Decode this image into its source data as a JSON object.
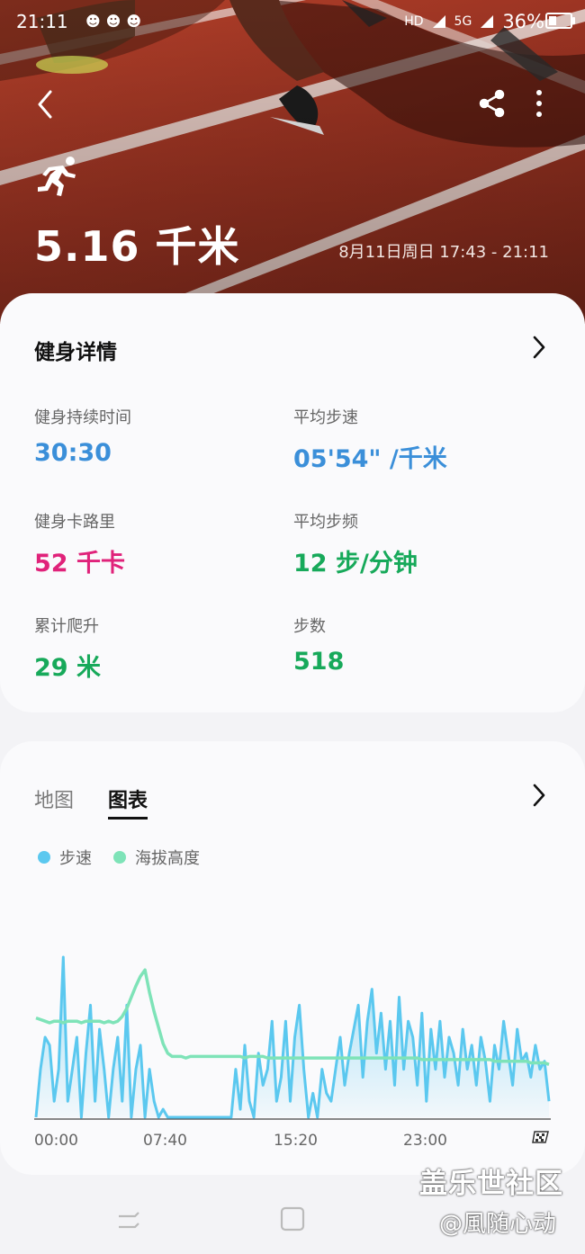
{
  "status": {
    "time": "21:11",
    "notif_icons": "☻☻☻",
    "hd": "HD",
    "net": "5G",
    "battery": "36%"
  },
  "header": {
    "back_icon": "chevron-left-icon",
    "share_icon": "share-icon",
    "more_icon": "more-vertical-icon",
    "activity_icon": "running-icon",
    "distance": "5.16 千米",
    "date_range": "8月11日周日 17:43 - 21:11"
  },
  "details": {
    "title": "健身详情",
    "stats": [
      {
        "label": "健身持续时间",
        "value": "30:30",
        "color": "#3b8fd9"
      },
      {
        "label": "平均步速",
        "value": "05'54\" /千米",
        "color": "#3b8fd9"
      },
      {
        "label": "健身卡路里",
        "value": "52 千卡",
        "color": "#e0227a"
      },
      {
        "label": "平均步频",
        "value": "12 步/分钟",
        "color": "#17a95a"
      },
      {
        "label": "累计爬升",
        "value": "29 米",
        "color": "#17a95a"
      },
      {
        "label": "步数",
        "value": "518",
        "color": "#17a95a"
      }
    ]
  },
  "chart_card": {
    "tab_map": "地图",
    "tab_chart": "图表",
    "legend_pace": "步速",
    "legend_altitude": "海拔高度",
    "pace_color": "#5bc8ef",
    "altitude_color": "#7ee3b8",
    "finish_icon": "finish-flag-icon"
  },
  "chart_data": {
    "type": "area",
    "x_ticks": [
      "00:00",
      "07:40",
      "15:20",
      "23:00"
    ],
    "xlim": [
      0,
      30.5
    ],
    "series": [
      {
        "name": "步速",
        "values": [
          0,
          0.3,
          0.5,
          0.45,
          0.1,
          0.3,
          1.0,
          0.1,
          0.3,
          0.5,
          0,
          0.4,
          0.7,
          0.1,
          0.55,
          0.3,
          0,
          0.3,
          0.5,
          0.1,
          0.7,
          0,
          0.3,
          0.45,
          0,
          0.3,
          0.1,
          0,
          0.05,
          0,
          0,
          0,
          0,
          0,
          0,
          0,
          0,
          0,
          0,
          0,
          0,
          0,
          0,
          0,
          0.3,
          0.05,
          0.45,
          0.1,
          0,
          0.4,
          0.2,
          0.3,
          0.6,
          0.1,
          0.25,
          0.6,
          0.1,
          0.5,
          0.7,
          0.3,
          0,
          0.15,
          0,
          0.3,
          0.15,
          0.1,
          0.3,
          0.5,
          0.2,
          0.4,
          0.55,
          0.7,
          0.25,
          0.6,
          0.8,
          0.4,
          0.65,
          0.3,
          0.6,
          0.2,
          0.75,
          0.3,
          0.6,
          0.5,
          0.2,
          0.65,
          0.1,
          0.55,
          0.3,
          0.6,
          0.25,
          0.5,
          0.4,
          0.2,
          0.55,
          0.3,
          0.45,
          0.2,
          0.5,
          0.35,
          0.1,
          0.45,
          0.3,
          0.6,
          0.4,
          0.2,
          0.55,
          0.35,
          0.4,
          0.25,
          0.45,
          0.3,
          0.35,
          0.1
        ],
        "unit_label": ""
      },
      {
        "name": "海拔高度",
        "values": [
          0.62,
          0.61,
          0.6,
          0.59,
          0.6,
          0.6,
          0.59,
          0.6,
          0.6,
          0.6,
          0.59,
          0.6,
          0.6,
          0.6,
          0.6,
          0.59,
          0.6,
          0.59,
          0.6,
          0.63,
          0.68,
          0.75,
          0.82,
          0.88,
          0.92,
          0.78,
          0.66,
          0.56,
          0.46,
          0.4,
          0.38,
          0.38,
          0.38,
          0.37,
          0.38,
          0.38,
          0.38,
          0.38,
          0.38,
          0.38,
          0.38,
          0.38,
          0.38,
          0.38,
          0.38,
          0.38,
          0.37,
          0.38,
          0.38,
          0.38,
          0.38,
          0.37,
          0.37,
          0.37,
          0.37,
          0.37,
          0.37,
          0.37,
          0.37,
          0.37,
          0.37,
          0.37,
          0.37,
          0.37,
          0.37,
          0.37,
          0.37,
          0.37,
          0.37,
          0.37,
          0.37,
          0.37,
          0.37,
          0.37,
          0.37,
          0.37,
          0.37,
          0.37,
          0.37,
          0.37,
          0.37,
          0.37,
          0.37,
          0.37,
          0.37,
          0.36,
          0.36,
          0.36,
          0.36,
          0.36,
          0.36,
          0.36,
          0.36,
          0.36,
          0.36,
          0.36,
          0.36,
          0.36,
          0.36,
          0.36,
          0.36,
          0.35,
          0.35,
          0.35,
          0.35,
          0.35,
          0.35,
          0.35,
          0.35,
          0.34,
          0.34,
          0.34,
          0.34,
          0.33
        ]
      }
    ],
    "grid": false,
    "legend_position": "top-left"
  },
  "watermark": {
    "line1": "盖乐世社区",
    "line2": "@風随心动"
  }
}
